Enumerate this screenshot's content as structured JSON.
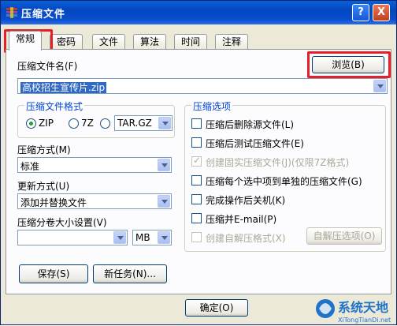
{
  "window": {
    "title": "压缩文件",
    "help_btn": "?",
    "close_btn": "X"
  },
  "tabs": [
    "常规",
    "密码",
    "文件",
    "算法",
    "时间",
    "注释"
  ],
  "general": {
    "archive_name_label": "压缩文件名(F)",
    "browse_button": "浏览(B)",
    "archive_name_value": "高校招生宣传片.zip",
    "format_group": {
      "title": "压缩文件格式",
      "options": [
        "ZIP",
        "7Z",
        "TAR.GZ"
      ],
      "selected": "ZIP"
    },
    "method_label": "压缩方式(M)",
    "method_value": "标准",
    "update_label": "更新方式(U)",
    "update_value": "添加并替换文件",
    "split_label": "压缩分卷大小设置(V)",
    "split_unit": "MB",
    "save_button": "保存(S)",
    "new_task_button": "新任务(N)...",
    "options_group": {
      "title": "压缩选项",
      "items": [
        "压缩后删除源文件(L)",
        "压缩后测试压缩文件(E)",
        "创建固实压缩文件(J)(仅限7Z格式)",
        "压缩每个选中项到单独的压缩文件(G)",
        "完成操作后关机(K)",
        "压缩并E-mail(P)",
        "创建自解压格式(X)"
      ],
      "sfx_options_button": "自解压选项(O)"
    },
    "ok_button": "确定(O)"
  },
  "watermark": {
    "text": "系统天地",
    "url_text": "XiTongTianDi.net"
  }
}
